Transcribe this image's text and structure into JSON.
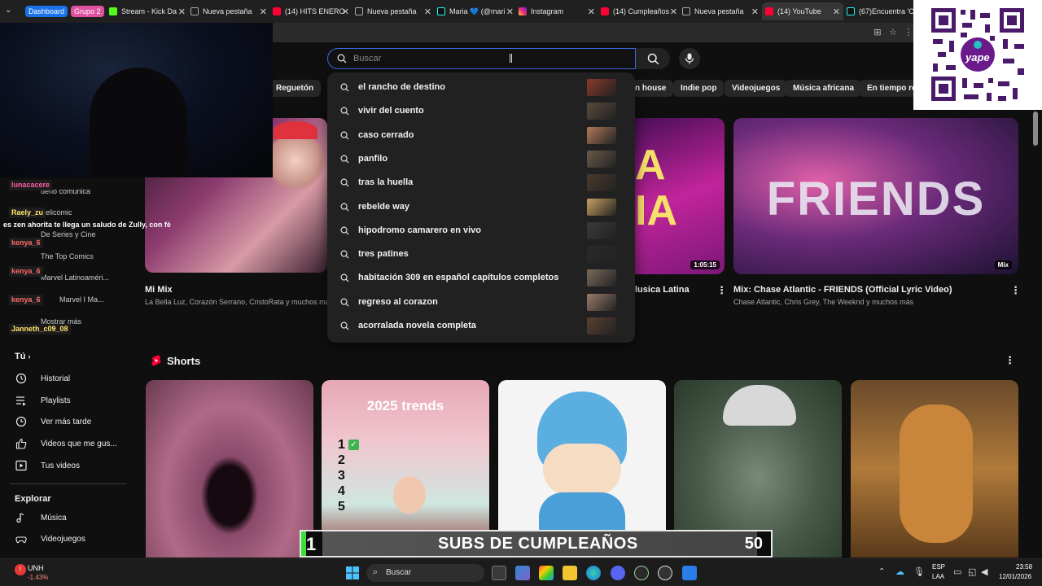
{
  "tabs": {
    "groups": [
      "Dashboard",
      "Grupo 2"
    ],
    "items": [
      {
        "label": "Stream - Kick Da"
      },
      {
        "label": "Nueva pestaña"
      },
      {
        "label": "(14) HITS ENERO"
      },
      {
        "label": "Nueva pestaña"
      },
      {
        "label": "Maria 💙 (@mari"
      },
      {
        "label": "Instagram"
      },
      {
        "label": "(14) Cumpleaños"
      },
      {
        "label": "Nueva pestaña"
      },
      {
        "label": "(14) YouTube"
      },
      {
        "label": "(67)Encuentra 'C"
      }
    ]
  },
  "search": {
    "placeholder": "Buscar",
    "suggestions": [
      "el rancho de destino",
      "vivir del cuento",
      "caso cerrado",
      "panfilo",
      "tras la huella",
      "rebelde way",
      "hipodromo camarero en vivo",
      "tres patines",
      "habitación 309 en español capítulos completos",
      "regreso al corazon",
      "acorralada novela completa"
    ]
  },
  "chips": [
    "Reguetón",
    "n house",
    "Indie pop",
    "Videojuegos",
    "Música africana",
    "En tiempo rea"
  ],
  "mixes": [
    {
      "title": "Mi Mix",
      "subtitle": "La Bella Luz, Corazón Serrano, CristoRata y muchos má"
    },
    {
      "title": "lusica Latina",
      "badge": "1:05:15"
    },
    {
      "title": "Mix: Chase Atlantic - FRIENDS (Official Lyric Video)",
      "subtitle": "Chase Atlantic, Chris Grey, The Weeknd y muchos más",
      "badge": "Mix",
      "thumb_text": "FRIENDS"
    }
  ],
  "sidebar": {
    "you_heading": "Tú",
    "items": [
      "Historial",
      "Playlists",
      "Ver más tarde",
      "Videos que me gus...",
      "Tus videos"
    ],
    "explore_heading": "Explorar",
    "explore_items": [
      "Música",
      "Videojuegos"
    ],
    "partial_items": [
      "ueño comunica",
      "elicomic",
      "De Series y Cine",
      "The Top Comics",
      "Marvel Latinoaméri...",
      "Marvel I Ma...",
      "Mostrar más"
    ]
  },
  "shorts": {
    "heading": "Shorts",
    "trend_text": "2025 trends",
    "trend_numbers": [
      "1",
      "2",
      "3",
      "4",
      "5"
    ]
  },
  "chat": {
    "messages": [
      {
        "user": "lunacacere",
        "text": ""
      },
      {
        "user": "Raely_zu",
        "text": ""
      },
      {
        "user": "",
        "text": "es zen ahorita te llega un saludo de Zully, con fé"
      },
      {
        "user": "kenya_6",
        "text": ""
      },
      {
        "user": "kenya_6",
        "text": ""
      },
      {
        "user": "kenya_6",
        "text": ""
      },
      {
        "user": "Janneth_c09_08",
        "text": ""
      }
    ]
  },
  "overlay": {
    "qr_brand": "yape",
    "sub_goal": {
      "current": "1",
      "label": "SUBS DE CUMPLEAÑOS",
      "target": "50"
    }
  },
  "taskbar": {
    "stock_name": "UNH",
    "stock_change": "-1.43%",
    "search_label": "Buscar",
    "lang": "ESP",
    "lang_sub": "LAA",
    "time": "23:58",
    "date": "12/01/2026"
  },
  "colors": {
    "accent_blue": "#3d6ae0",
    "youtube_red": "#ff0033",
    "group_dashboard": "#1a73e8",
    "group_grupo2": "#e052a0",
    "kick_green": "#53fc18"
  }
}
